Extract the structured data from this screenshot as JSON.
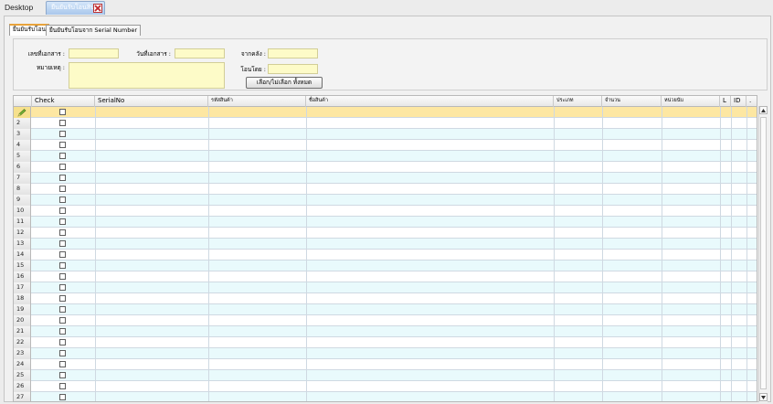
{
  "tabs": {
    "desktop_label": "Desktop",
    "active_label": "ยืนยันรับโอนสินค้า"
  },
  "subtabs": [
    {
      "label": "ยืนยันรับโอน"
    },
    {
      "label": "ยืนยันรับโอนจาก Serial Number"
    }
  ],
  "form": {
    "doc_no_label": "เลขที่เอกสาร :",
    "doc_date_label": "วันที่เอกสาร :",
    "from_wh_label": "จากคลัง :",
    "remark_label": "หมายเหตุ :",
    "transfer_by_label": "โอนโดย :",
    "doc_no_value": "",
    "doc_date_value": "",
    "from_wh_value": "",
    "remark_value": "",
    "transfer_by_value": "",
    "select_all_button": "เลือก/ไม่เลือก ทั้งหมด"
  },
  "grid": {
    "columns": [
      "Check",
      "SerialNo",
      "รหัสสินค้า",
      "ชื่อสินค้า",
      "ประเภท",
      "จำนวน",
      "หน่วยนับ",
      "L",
      "ID",
      "."
    ],
    "row_numbers": [
      "",
      "2",
      "3",
      "4",
      "5",
      "6",
      "7",
      "8",
      "9",
      "10",
      "11",
      "12",
      "13",
      "14",
      "15",
      "16",
      "17",
      "18",
      "19",
      "20",
      "21",
      "22",
      "23",
      "24",
      "25",
      "26",
      "27"
    ]
  },
  "colors": {
    "field_bg": "#fdfbc8",
    "active_row": "#fde7a2",
    "alt_row": "#e9fafc",
    "tab_accent": "#e8a33b"
  }
}
